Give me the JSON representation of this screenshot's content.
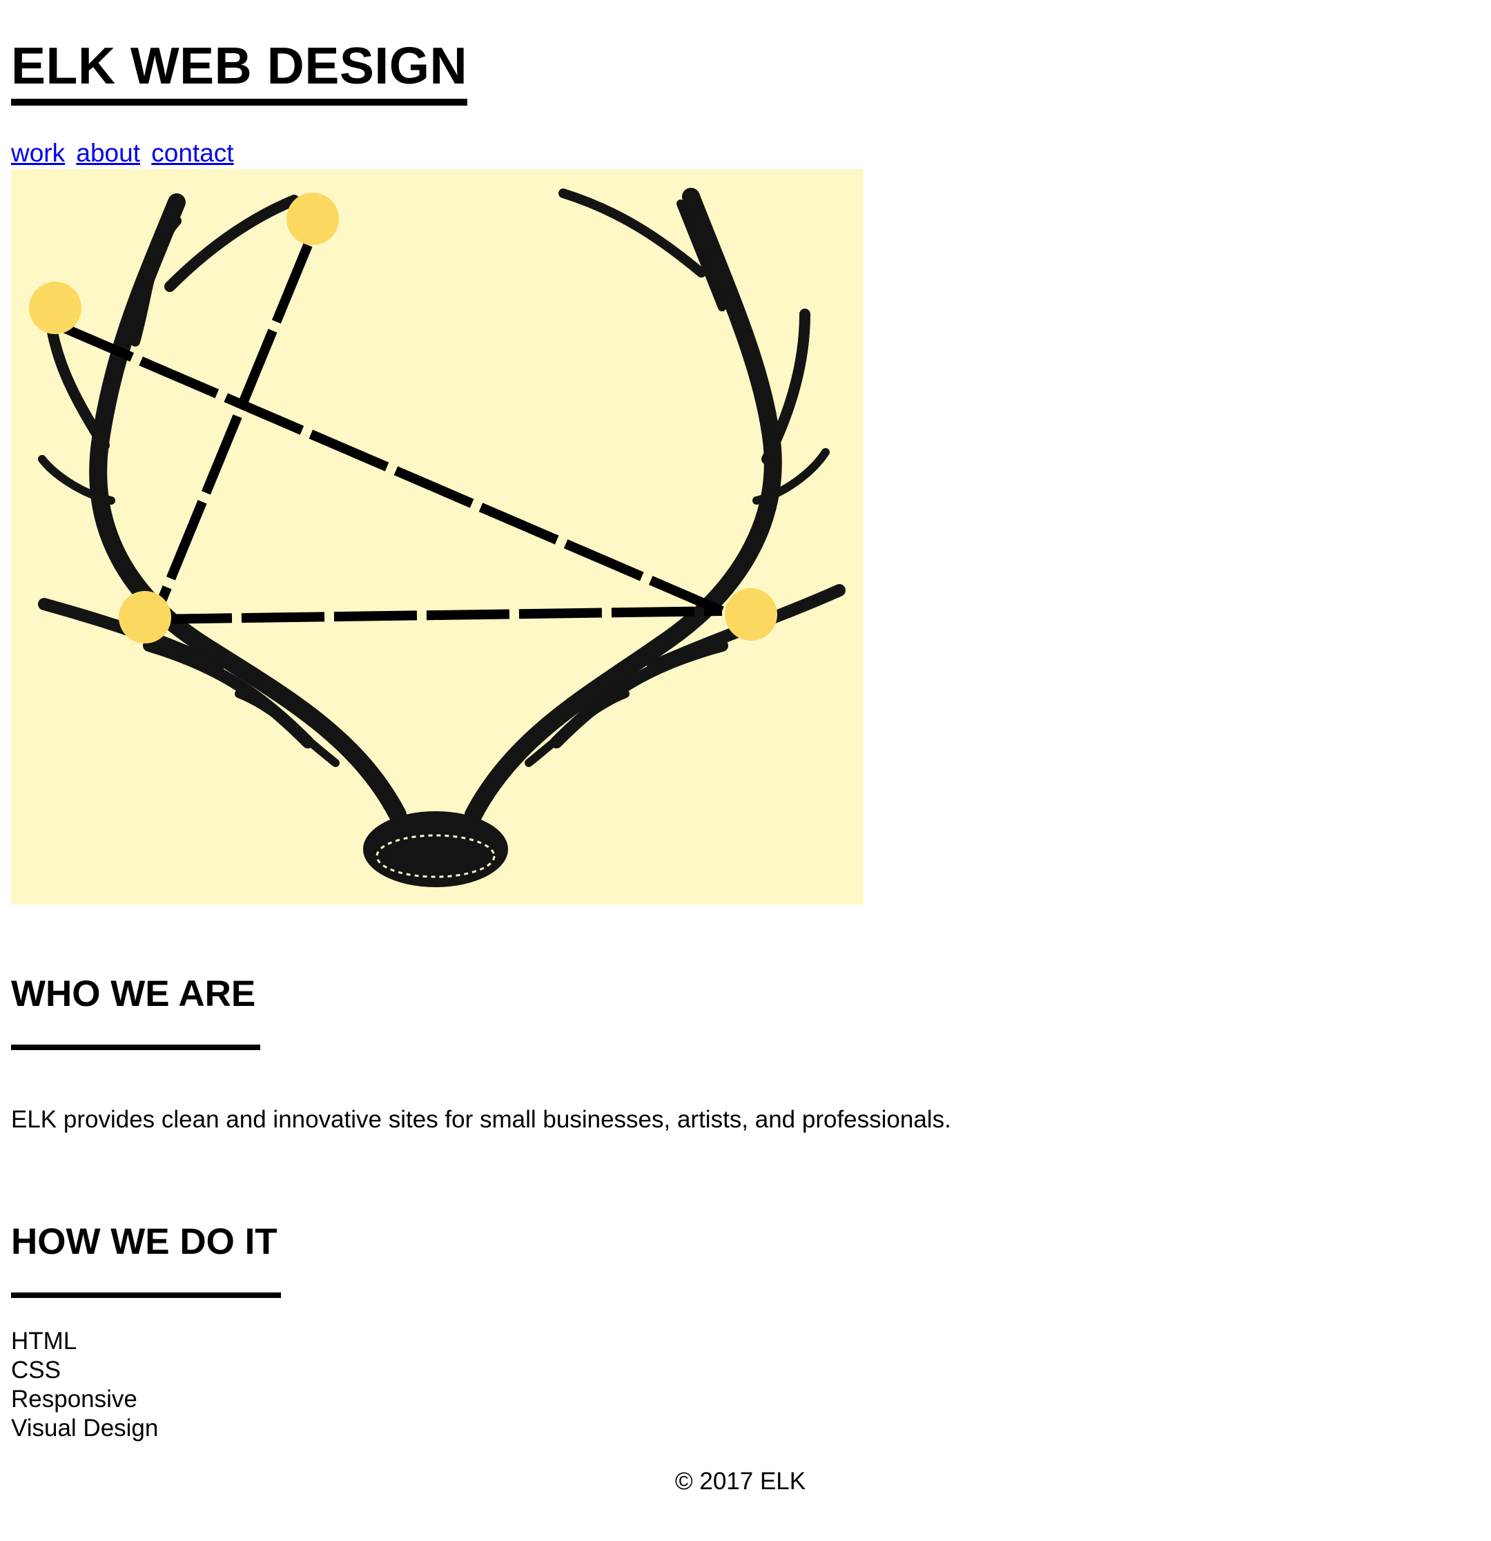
{
  "header": {
    "title": "ELK WEB DESIGN"
  },
  "nav": {
    "links": [
      {
        "label": "work"
      },
      {
        "label": "about"
      },
      {
        "label": "contact"
      }
    ]
  },
  "colors": {
    "link": "#0000ee",
    "hero_background": "#fdf8c5",
    "dot": "#fbd960"
  },
  "sections": {
    "who": {
      "title": "WHO WE ARE",
      "text": "ELK provides clean and innovative sites for small businesses, artists, and professionals."
    },
    "how": {
      "title": "HOW WE DO IT",
      "items": [
        "HTML",
        "CSS",
        "Responsive",
        "Visual Design"
      ]
    }
  },
  "footer": {
    "text": "© 2017 ELK"
  }
}
